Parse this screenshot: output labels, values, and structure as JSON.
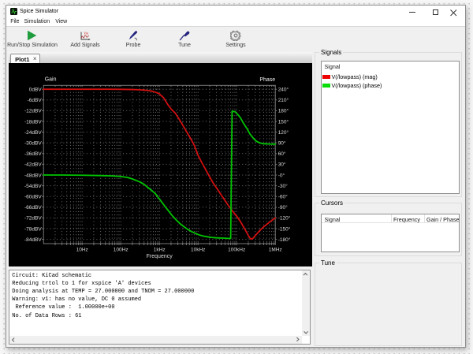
{
  "window": {
    "title": "Spice Simulator"
  },
  "menu": {
    "items": [
      "File",
      "Simulation",
      "View"
    ]
  },
  "toolbar": {
    "items": [
      {
        "label": "Run/Stop Simulation",
        "icon": "run-icon"
      },
      {
        "label": "Add Signals",
        "icon": "add-signals-icon",
        "icon_text": "Vin"
      },
      {
        "label": "Probe",
        "icon": "probe-icon"
      },
      {
        "label": "Tune",
        "icon": "tune-icon"
      },
      {
        "label": "Settings",
        "icon": "gear-icon"
      }
    ],
    "run_icon_color": "#1f9c3d"
  },
  "tabs": [
    {
      "label": "Plot1",
      "close_glyph": "×"
    }
  ],
  "signals_panel": {
    "title": "Signals",
    "column_header": "Signal",
    "rows": [
      {
        "label": "V(/lowpass) (mag)",
        "color": "#ec0000"
      },
      {
        "label": "V(/lowpass) (phase)",
        "color": "#0adc0a"
      }
    ]
  },
  "cursors_panel": {
    "title": "Cursors",
    "columns": [
      "Signal",
      "Frequency",
      "Gain / Phase"
    ],
    "rows": []
  },
  "tune_panel": {
    "title": "Tune"
  },
  "console": {
    "lines": [
      "Circuit: KiCad schematic",
      "Reducing trtol to 1 for xspice 'A' devices",
      "Doing analysis at TEMP = 27.000000 and TNOM = 27.000000",
      "Warning: v1: has no value, DC 0 assumed",
      " Reference value :  1.00000e+00",
      "No. of Data Rows : 61"
    ]
  },
  "chart_data": {
    "type": "line",
    "x_axis": {
      "label": "Frequency",
      "scale": "log",
      "min": 1,
      "max": 1000000,
      "tick_values": [
        10,
        100,
        1000,
        10000,
        100000,
        1000000
      ],
      "tick_labels": [
        "10Hz",
        "100Hz",
        "1kHz",
        "10kHz",
        "100kHz",
        "1MHz"
      ]
    },
    "y_left": {
      "label": "Gain",
      "max": 0,
      "min": -84,
      "step": 6,
      "tick_labels": [
        "0dBV",
        "-6dBV",
        "-12dBV",
        "-18dBV",
        "-24dBV",
        "-30dBV",
        "-36dBV",
        "-42dBV",
        "-48dBV",
        "-54dBV",
        "-60dBV",
        "-66dBV",
        "-72dBV",
        "-78dBV",
        "-84dBV"
      ]
    },
    "y_right": {
      "label": "Phase",
      "max": 240,
      "min": -180,
      "step": 30,
      "tick_labels": [
        "240°",
        "210°",
        "180°",
        "150°",
        "120°",
        "90°",
        "60°",
        "30°",
        "-0°",
        "-30°",
        "-60°",
        "-90°",
        "-120°",
        "-150°",
        "-180°"
      ]
    },
    "grid_color": "#6e6e6e",
    "frame_color": "#787878",
    "tick_text_color": "#dcdcdc",
    "series": [
      {
        "name": "V(/lowpass) (mag)",
        "axis": "left",
        "color": "#cf1010",
        "points": [
          [
            1,
            0
          ],
          [
            2,
            0
          ],
          [
            5,
            0
          ],
          [
            10,
            0
          ],
          [
            20,
            0
          ],
          [
            50,
            0
          ],
          [
            100,
            -0.05
          ],
          [
            200,
            -0.15
          ],
          [
            300,
            -0.3
          ],
          [
            400,
            -0.5
          ],
          [
            500,
            -0.7
          ],
          [
            630,
            -1.0
          ],
          [
            800,
            -1.7
          ],
          [
            1000,
            -2.6
          ],
          [
            1300,
            -4.9
          ],
          [
            1650,
            -8.6
          ],
          [
            2000,
            -11.0
          ],
          [
            2600,
            -13.5
          ],
          [
            3200,
            -16.5
          ],
          [
            4000,
            -20.0
          ],
          [
            5000,
            -23.6
          ],
          [
            6300,
            -27.3
          ],
          [
            8000,
            -31.3
          ],
          [
            10000,
            -37.0
          ],
          [
            12500,
            -41.0
          ],
          [
            16000,
            -45.2
          ],
          [
            20000,
            -49.0
          ],
          [
            25000,
            -52.7
          ],
          [
            32000,
            -56.0
          ],
          [
            40000,
            -59.2
          ],
          [
            50000,
            -62.3
          ],
          [
            64000,
            -65.7
          ],
          [
            80000,
            -68.5
          ],
          [
            100000,
            -71.0
          ],
          [
            125000,
            -74.0
          ],
          [
            160000,
            -78.0
          ],
          [
            200000,
            -81.8
          ],
          [
            230000,
            -83.8
          ],
          [
            260000,
            -83.6
          ],
          [
            300000,
            -82.0
          ],
          [
            400000,
            -79.0
          ],
          [
            500000,
            -77.0
          ],
          [
            650000,
            -75.0
          ],
          [
            800000,
            -73.5
          ],
          [
            1000000,
            -72.0
          ]
        ]
      },
      {
        "name": "V(/lowpass) (phase)",
        "axis": "right",
        "color": "#00c400",
        "points": [
          [
            1,
            0
          ],
          [
            3,
            0
          ],
          [
            10,
            -0.5
          ],
          [
            30,
            -1.5
          ],
          [
            60,
            -2.5
          ],
          [
            100,
            -4.2
          ],
          [
            150,
            -7
          ],
          [
            200,
            -11
          ],
          [
            315,
            -19.5
          ],
          [
            400,
            -26
          ],
          [
            500,
            -34.5
          ],
          [
            630,
            -43
          ],
          [
            800,
            -53
          ],
          [
            1000,
            -67
          ],
          [
            1400,
            -88
          ],
          [
            1800,
            -103
          ],
          [
            2200,
            -115
          ],
          [
            2800,
            -127
          ],
          [
            3500,
            -137
          ],
          [
            4500,
            -146
          ],
          [
            5600,
            -153
          ],
          [
            7000,
            -159
          ],
          [
            8900,
            -164
          ],
          [
            11000,
            -168
          ],
          [
            14000,
            -171
          ],
          [
            18000,
            -173
          ],
          [
            22000,
            -174.5
          ],
          [
            28000,
            -175.5
          ],
          [
            35000,
            -176
          ],
          [
            45000,
            -176.5
          ],
          [
            55000,
            -177
          ],
          [
            70000,
            -177.5
          ],
          [
            76000,
            178.5
          ],
          [
            90000,
            177.5
          ],
          [
            110000,
            168
          ],
          [
            127000,
            159
          ],
          [
            150000,
            145
          ],
          [
            185000,
            130
          ],
          [
            220000,
            115
          ],
          [
            270000,
            103
          ],
          [
            320000,
            95
          ],
          [
            390000,
            90
          ],
          [
            500000,
            87.5
          ],
          [
            700000,
            86.8
          ],
          [
            1000000,
            86.5
          ]
        ]
      }
    ]
  }
}
